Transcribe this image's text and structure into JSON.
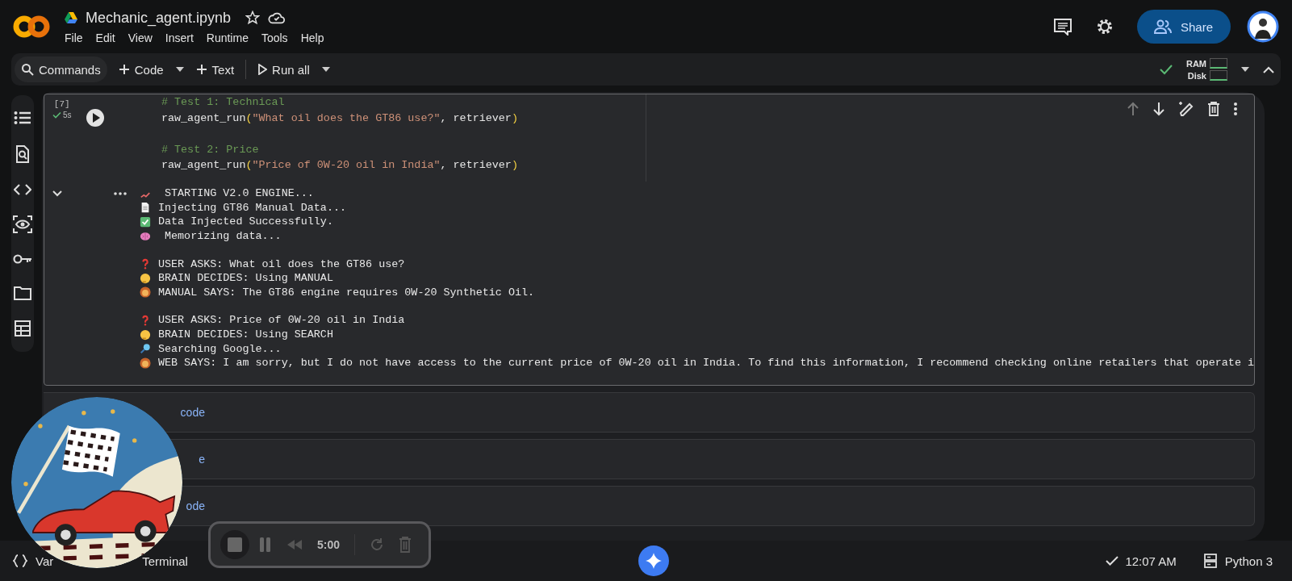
{
  "notebook": {
    "title": "Mechanic_agent.ipynb",
    "starred": false
  },
  "menu": [
    "File",
    "Edit",
    "View",
    "Insert",
    "Runtime",
    "Tools",
    "Help"
  ],
  "share": "Share",
  "toolbar": {
    "commands": "Commands",
    "code": "Code",
    "text": "Text",
    "run_all": "Run all",
    "ram": "RAM",
    "disk": "Disk",
    "connected": true
  },
  "sidebar": [
    {
      "kind": "list"
    },
    {
      "kind": "search"
    },
    {
      "kind": "code"
    },
    {
      "kind": "eye"
    },
    {
      "kind": "key"
    },
    {
      "kind": "folder"
    },
    {
      "kind": "table"
    }
  ],
  "cell": {
    "exec_count": "[7]",
    "duration": "5s",
    "succeeded": true,
    "code": [
      [
        [
          {
            "kind": "comment",
            "text": "# Test 1: Technical"
          }
        ],
        [
          {
            "kind": "name",
            "text": "raw_agent_run"
          },
          {
            "kind": "paren",
            "text": "("
          },
          {
            "kind": "string",
            "text": "\"What oil does the GT86 use?\""
          },
          {
            "kind": "name",
            "text": ", retriever"
          },
          {
            "kind": "paren",
            "text": ")"
          }
        ]
      ],
      [
        [
          {
            "kind": "comment",
            "text": "# Test 2: Price"
          }
        ],
        [
          {
            "kind": "name",
            "text": "raw_agent_run"
          },
          {
            "kind": "paren",
            "text": "("
          },
          {
            "kind": "string",
            "text": "\"Price of 0W-20 oil in India\""
          },
          {
            "kind": "name",
            "text": ", retriever"
          },
          {
            "kind": "paren",
            "text": ")"
          }
        ]
      ]
    ],
    "output": [
      [
        {
          "kind": "chart",
          "text": " STARTING V2.0 ENGINE..."
        },
        {
          "kind": "document",
          "text": "Injecting GT86 Manual Data..."
        },
        {
          "kind": "check",
          "text": "Data Injected Successfully."
        },
        {
          "kind": "brain",
          "text": " Memorizing data..."
        }
      ],
      [
        {
          "kind": "question",
          "text": "USER ASKS: What oil does the GT86 use?"
        },
        {
          "kind": "thinking",
          "text": "BRAIN DECIDES: Using MANUAL"
        },
        {
          "kind": "lion",
          "text": "MANUAL SAYS: The GT86 engine requires 0W-20 Synthetic Oil."
        }
      ],
      [
        {
          "kind": "question",
          "text": "USER ASKS: Price of 0W-20 oil in India"
        },
        {
          "kind": "thinking",
          "text": "BRAIN DECIDES: Using SEARCH"
        },
        {
          "kind": "magnifier",
          "text": "Searching Google..."
        },
        {
          "kind": "lion",
          "text": "WEB SAYS: I am sorry, but I do not have access to the current price of 0W-20 oil in India. To find this information, I recommend checking online retailers that operate i"
        }
      ]
    ]
  },
  "collapsed_cells": [
    "code",
    "e",
    "ode"
  ],
  "recorder": {
    "time": "5:00"
  },
  "status_bar": {
    "variables": "Var",
    "terminal": "Terminal",
    "time": "12:07 AM",
    "runtime": "Python 3",
    "saved": true
  }
}
